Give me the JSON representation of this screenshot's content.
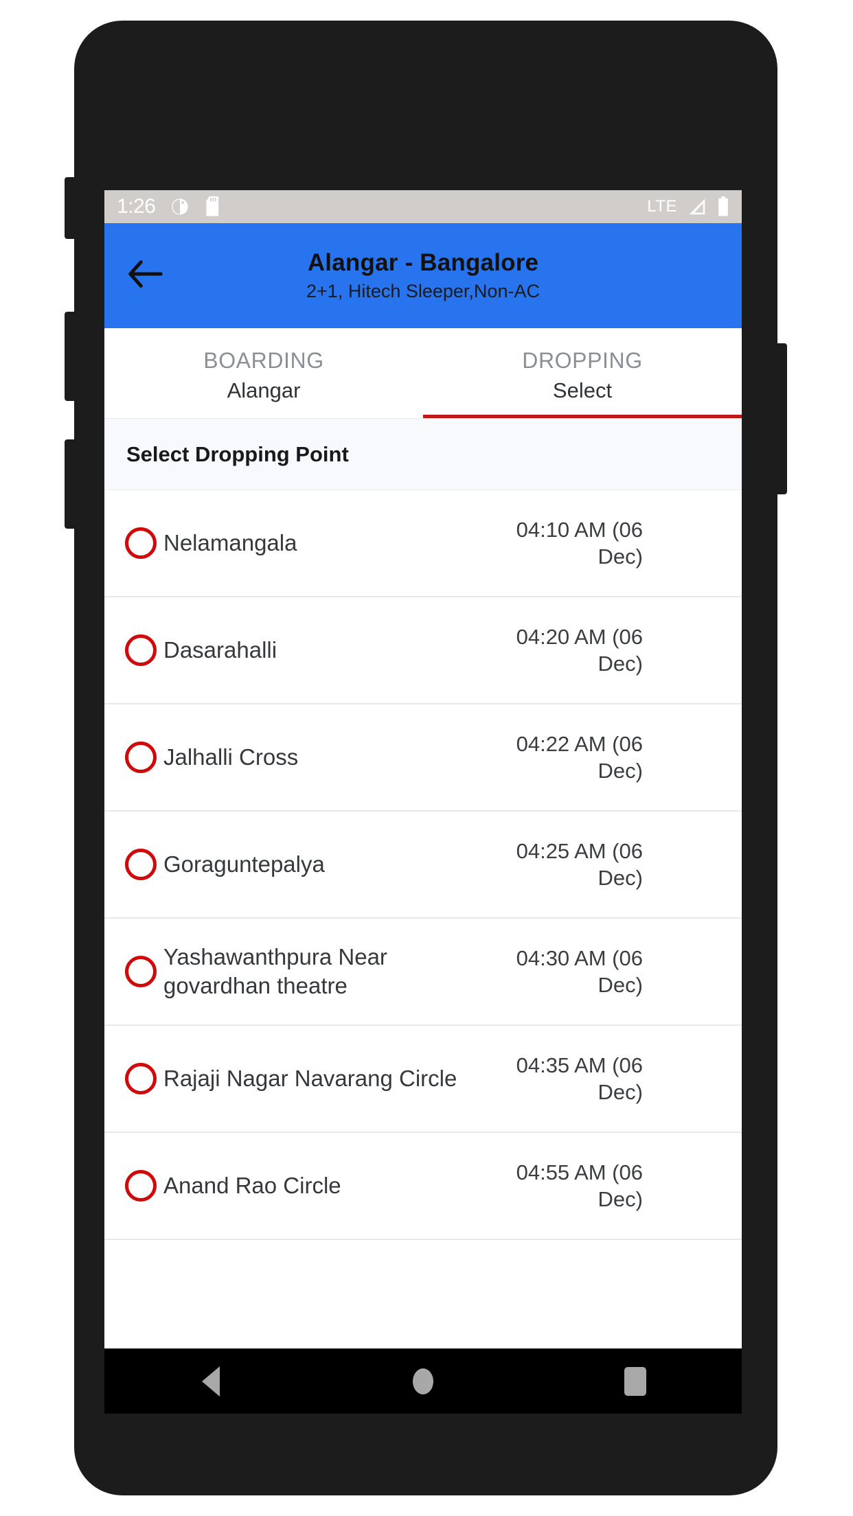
{
  "status_bar": {
    "time": "1:26",
    "network_label": "LTE",
    "icons": [
      "clock-face-icon",
      "sd-card-icon",
      "signal-icon",
      "battery-icon"
    ]
  },
  "app_bar": {
    "back_icon": "arrow-left-icon",
    "title": "Alangar - Bangalore",
    "subtitle": "2+1, Hitech Sleeper,Non-AC",
    "background_color": "#2874EE"
  },
  "tabs": [
    {
      "label": "BOARDING",
      "value": "Alangar",
      "active": false
    },
    {
      "label": "DROPPING",
      "value": "Select",
      "active": true
    }
  ],
  "tab_indicator_color": "#C01717",
  "section": {
    "title": "Select Dropping Point"
  },
  "stops": [
    {
      "name": "Nelamangala",
      "time": "04:10 AM (06 Dec)",
      "selected": false
    },
    {
      "name": "Dasarahalli",
      "time": "04:20 AM (06 Dec)",
      "selected": false
    },
    {
      "name": "Jalhalli Cross",
      "time": "04:22 AM (06 Dec)",
      "selected": false
    },
    {
      "name": "Goraguntepalya",
      "time": "04:25 AM (06 Dec)",
      "selected": false
    },
    {
      "name": "Yashawanthpura Near govardhan theatre",
      "time": "04:30 AM (06 Dec)",
      "selected": false
    },
    {
      "name": "Rajaji Nagar Navarang Circle",
      "time": "04:35 AM (06 Dec)",
      "selected": false
    },
    {
      "name": "Anand Rao Circle",
      "time": "04:55 AM (06 Dec)",
      "selected": false
    }
  ],
  "radio_color": "#D00A0A",
  "nav_bar": {
    "back": "triangle-back-icon",
    "home": "circle-home-icon",
    "recents": "square-recents-icon"
  }
}
